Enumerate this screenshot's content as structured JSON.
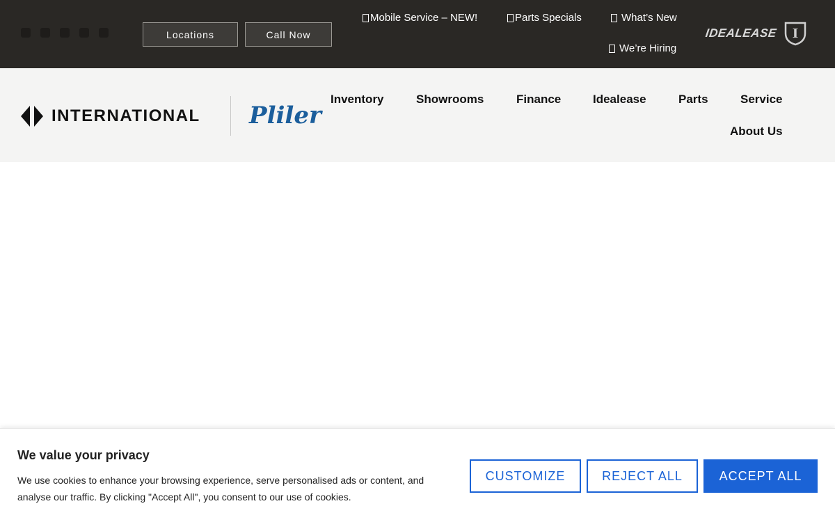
{
  "topbar": {
    "buttons": {
      "locations": "Locations",
      "call_now": "Call Now"
    },
    "links": {
      "mobile_service": "Mobile Service – NEW!",
      "parts_specials": "Parts Specials",
      "whats_new": "What’s New",
      "were_hiring": "We’re Hiring"
    },
    "idealease_logo_text": "IDEALEASE",
    "social_icons": [
      "facebook-icon",
      "instagram-icon",
      "linkedin-icon",
      "youtube-icon",
      "twitter-icon"
    ]
  },
  "header": {
    "brand": "INTERNATIONAL",
    "dealer": "Pliler",
    "nav": [
      "Inventory",
      "Showrooms",
      "Finance",
      "Idealease",
      "Parts",
      "Service",
      "About Us"
    ]
  },
  "cookie": {
    "title": "We value your privacy",
    "text": "We use cookies to enhance your browsing experience, serve personalised ads or content, and analyse our traffic. By clicking \"Accept All\", you consent to our use of cookies.",
    "customize": "CUSTOMIZE",
    "reject": "REJECT ALL",
    "accept": "ACCEPT ALL"
  },
  "colors": {
    "topbar_bg": "#2a2825",
    "header_bg": "#f4f4f3",
    "dealer_blue": "#1b5e9c",
    "cookie_accent": "#1b63d6"
  }
}
